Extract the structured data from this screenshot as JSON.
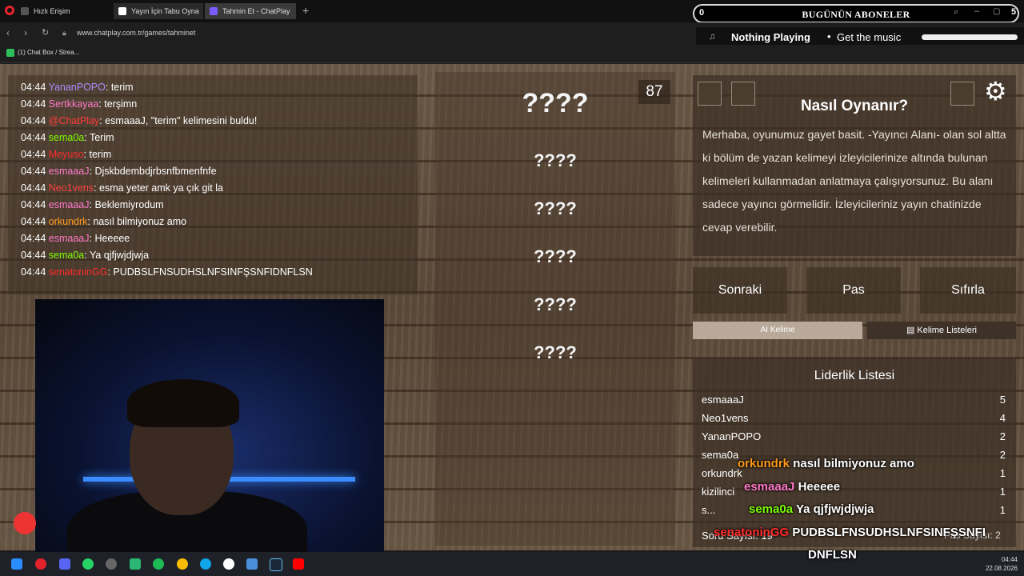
{
  "browser": {
    "tabs": [
      {
        "label": "Hızlı Erişim"
      },
      {
        "label": "Yayın İçin Tabu Oyna"
      },
      {
        "label": "Tahmin Et - ChatPlay"
      }
    ],
    "url": "www.chatplay.com.tr/games/tahminet",
    "bookmark": "(1) Chat Box / Strea..."
  },
  "overlay": {
    "sub_count": "0",
    "sub_title": "BUGÜNÜN ABONELER",
    "music_now": "Nothing Playing",
    "music_cta": "Get the music",
    "corner_count": "5"
  },
  "chat": {
    "messages": [
      {
        "time": "04:44",
        "user": "YananPOPO",
        "text": ": terim",
        "color": "#a98cff"
      },
      {
        "time": "04:44",
        "user": "Sertkkayaa",
        "text": ": terşimn",
        "color": "#ff7ac8"
      },
      {
        "time": "04:44",
        "user": "@ChatPlay",
        "text": ": esmaaaJ, \"terim\" kelimesini buldu!",
        "color": "#ff3b3b"
      },
      {
        "time": "04:44",
        "user": "sema0a",
        "text": ": Terim",
        "color": "#7CFC00"
      },
      {
        "time": "04:44",
        "user": "Meyuso",
        "text": ": terim",
        "color": "#ff2b2b"
      },
      {
        "time": "04:44",
        "user": "esmaaaJ",
        "text": ": Djskbdembdjrbsnfbmenfnfe",
        "color": "#ff7ac8"
      },
      {
        "time": "04:44",
        "user": "Neo1vens",
        "text": ": esma yeter amk ya çık git la",
        "color": "#ff4040"
      },
      {
        "time": "04:44",
        "user": "esmaaaJ",
        "text": ": Beklemiyrodum",
        "color": "#ff7ac8"
      },
      {
        "time": "04:44",
        "user": "orkundrk",
        "text": ": nasıl bilmiyonuz amo",
        "color": "#ff9a1a"
      },
      {
        "time": "04:44",
        "user": "esmaaaJ",
        "text": ": Heeeee",
        "color": "#ff7ac8"
      },
      {
        "time": "04:44",
        "user": "sema0a",
        "text": ": Ya qjfjwjdjwja",
        "color": "#7CFC00"
      },
      {
        "time": "04:44",
        "user": "senatoninGG",
        "text": ": PUDBSLFNSUDHSLNFSINFŞSNFIDNFLSN",
        "color": "#ff2b2b"
      }
    ]
  },
  "game": {
    "timer": "87",
    "words": [
      "????",
      "????",
      "????",
      "????",
      "????",
      "????"
    ],
    "how_title": "Nasıl Oynanır?",
    "how_text": "Merhaba, oyunumuz gayet basit. -Yayıncı Alanı- olan sol altta ki bölüm de yazan kelimeyi izleyicilerinize altında bulunan kelimeleri kullanmadan anlatmaya çalışıyorsunuz. Bu alanı sadece yayıncı görmelidir. İzleyicileriniz yayın chatinizde cevap verebilir.",
    "buttons": {
      "next": "Sonraki",
      "pass": "Pas",
      "reset": "Sıfırla"
    },
    "ai_word": "AI Kelime",
    "word_lists": "Kelime Listeleri"
  },
  "leaderboard": {
    "title": "Liderlik Listesi",
    "rows": [
      {
        "name": "esmaaaJ",
        "score": "5"
      },
      {
        "name": "Neo1vens",
        "score": "4"
      },
      {
        "name": "YananPOPO",
        "score": "2"
      },
      {
        "name": "sema0a",
        "score": "2"
      },
      {
        "name": "orkundrk",
        "score": "1"
      },
      {
        "name": "kizilinci",
        "score": "1"
      },
      {
        "name": "s...",
        "score": "1"
      }
    ],
    "question_count": "Soru Sayısı: 19",
    "pass_count": "Pas Sayısı: 2"
  },
  "popups": [
    {
      "user": "orkundrk",
      "text": "nasıl bilmiyonuz amo",
      "color": "#ff9a1a"
    },
    {
      "user": "esmaaaJ",
      "text": "Heeeee",
      "color": "#ff7ac8"
    },
    {
      "user": "sema0a",
      "text": "Ya qjfjwjdjwja",
      "color": "#7CFC00"
    },
    {
      "user": "senatoninGG",
      "text": "PUDBSLFNSUDHSLNFSINFŞSNFI",
      "color": "#ff2b2b"
    },
    {
      "user": "",
      "text": "DNFLSN",
      "color": "#ffffff"
    }
  ],
  "taskbar": {
    "time": "04:44",
    "date": "22.08.2026"
  },
  "colors": {
    "accent_red": "#ff2b2b",
    "wood": "#6c5a48"
  }
}
